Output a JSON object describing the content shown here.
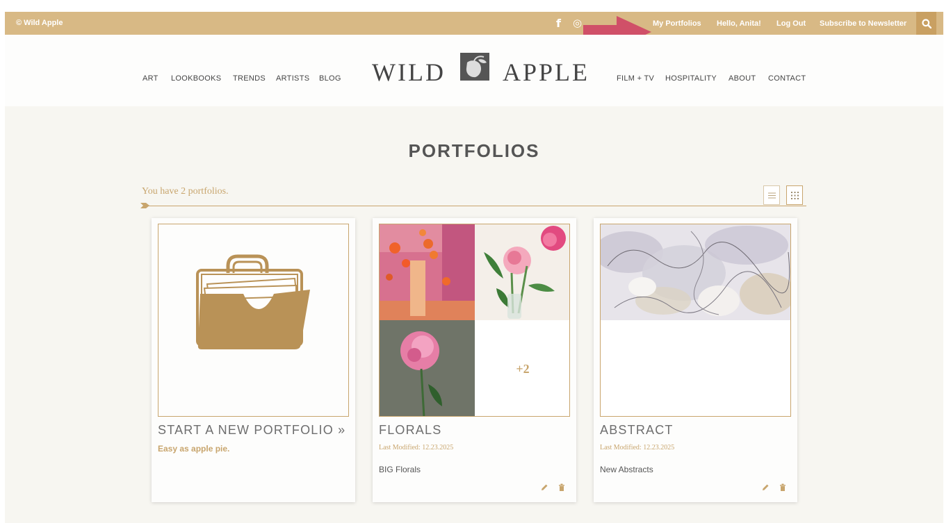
{
  "topbar": {
    "copyright": "© Wild Apple",
    "social": [
      {
        "icon": "facebook-icon",
        "glyph": "f"
      },
      {
        "icon": "instagram-icon",
        "glyph": "◎"
      }
    ],
    "links": {
      "my_portfolios": "My Portfolios",
      "hello": "Hello, Anita!",
      "logout": "Log Out",
      "subscribe": "Subscribe to Newsletter"
    },
    "search_icon": "search-icon",
    "bar_color": "#d8b985"
  },
  "header": {
    "nav_left": [
      "ART",
      "LOOKBOOKS",
      "TRENDS",
      "ARTISTS",
      "BLOG"
    ],
    "logo_left": "WILD",
    "logo_right": "APPLE",
    "nav_right": [
      "FILM + TV",
      "HOSPITALITY",
      "ABOUT",
      "CONTACT"
    ]
  },
  "page": {
    "title": "PORTFOLIOS",
    "count_text": "You have 2 portfolios.",
    "view_options": [
      "list-view-icon",
      "grid-view-icon"
    ]
  },
  "cards": {
    "new": {
      "title": "START A NEW PORTFOLIO »",
      "subtitle": "Easy as apple pie."
    },
    "florals": {
      "title": "FLORALS",
      "date": "Last Modified: 12.23.2025",
      "description": "BIG Florals",
      "extra_count": "+2"
    },
    "abstract": {
      "title": "ABSTRACT",
      "date": "Last Modified: 12.23.2025",
      "description": "New Abstracts"
    }
  },
  "colors": {
    "accent": "#c8a56d",
    "annotation_arrow": "#d05068"
  }
}
